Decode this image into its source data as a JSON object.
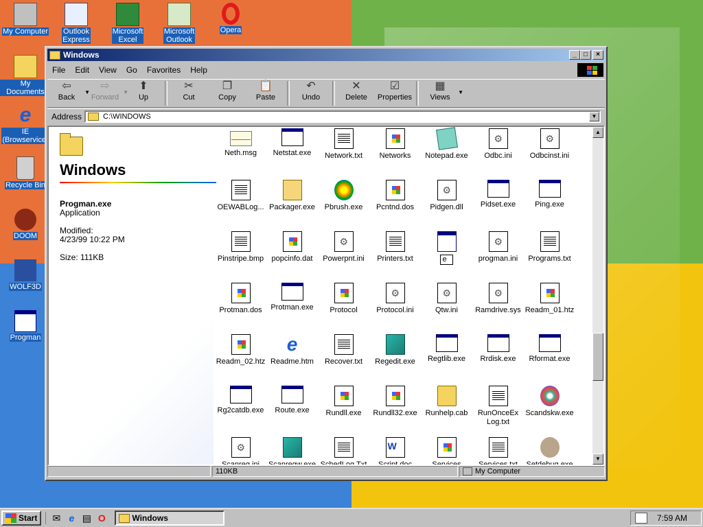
{
  "desktop": {
    "icons": [
      {
        "label": "My Computer"
      },
      {
        "label": "Outlook\nExpress"
      },
      {
        "label": "Microsoft\nExcel"
      },
      {
        "label": "Microsoft\nOutlook"
      },
      {
        "label": "Opera"
      },
      {
        "label": "My Documents"
      },
      {
        "label": "IE\n(Browservice)"
      },
      {
        "label": "Recycle Bin"
      },
      {
        "label": "DOOM"
      },
      {
        "label": "WOLF3D"
      },
      {
        "label": "Progman"
      }
    ]
  },
  "window": {
    "title": "Windows",
    "menu": [
      "File",
      "Edit",
      "View",
      "Go",
      "Favorites",
      "Help"
    ],
    "toolbar": {
      "back": "Back",
      "forward": "Forward",
      "up": "Up",
      "cut": "Cut",
      "copy": "Copy",
      "paste": "Paste",
      "undo": "Undo",
      "delete": "Delete",
      "properties": "Properties",
      "views": "Views"
    },
    "address": {
      "label": "Address",
      "value": "C:\\WINDOWS"
    },
    "info": {
      "folder": "Windows",
      "filename": "Progman.exe",
      "filetype": "Application",
      "modified_label": "Modified:",
      "modified": "4/23/99 10:22 PM",
      "size": "Size: 111KB"
    },
    "files": [
      [
        "Neth.msg",
        "Netstat.exe",
        "Network.txt",
        "Networks",
        "Notepad.exe",
        "Odbc.ini",
        "Odbcinst.ini"
      ],
      [
        "OEWABLog...",
        "Packager.exe",
        "Pbrush.exe",
        "Pcntnd.dos",
        "Pidgen.dll",
        "Pidset.exe",
        "Ping.exe"
      ],
      [
        "Pinstripe.bmp",
        "popcinfo.dat",
        "Powerpnt.ini",
        "Printers.txt",
        "e",
        "progman.ini",
        "Programs.txt"
      ],
      [
        "Protman.dos",
        "Protman.exe",
        "Protocol",
        "Protocol.ini",
        "Qtw.ini",
        "Ramdrive.sys",
        "Readm_01.htz"
      ],
      [
        "Readm_02.htz",
        "Readme.htm",
        "Recover.txt",
        "Regedit.exe",
        "Regtlib.exe",
        "Rrdisk.exe",
        "Rformat.exe"
      ],
      [
        "Rg2catdb.exe",
        "Route.exe",
        "Rundll.exe",
        "Rundll32.exe",
        "Runhelp.cab",
        "RunOnceEx\nLog.txt",
        "Scandskw.exe"
      ],
      [
        "Scanreg.ini",
        "Scanregw.exe",
        "SchedLog.Txt",
        "Script.doc",
        "Services",
        "Services.txt",
        "Setdebug.exe"
      ]
    ],
    "status": {
      "size": "110KB",
      "location": "My Computer"
    }
  },
  "taskbar": {
    "start": "Start",
    "task": "Windows",
    "clock": "7:59 AM"
  }
}
